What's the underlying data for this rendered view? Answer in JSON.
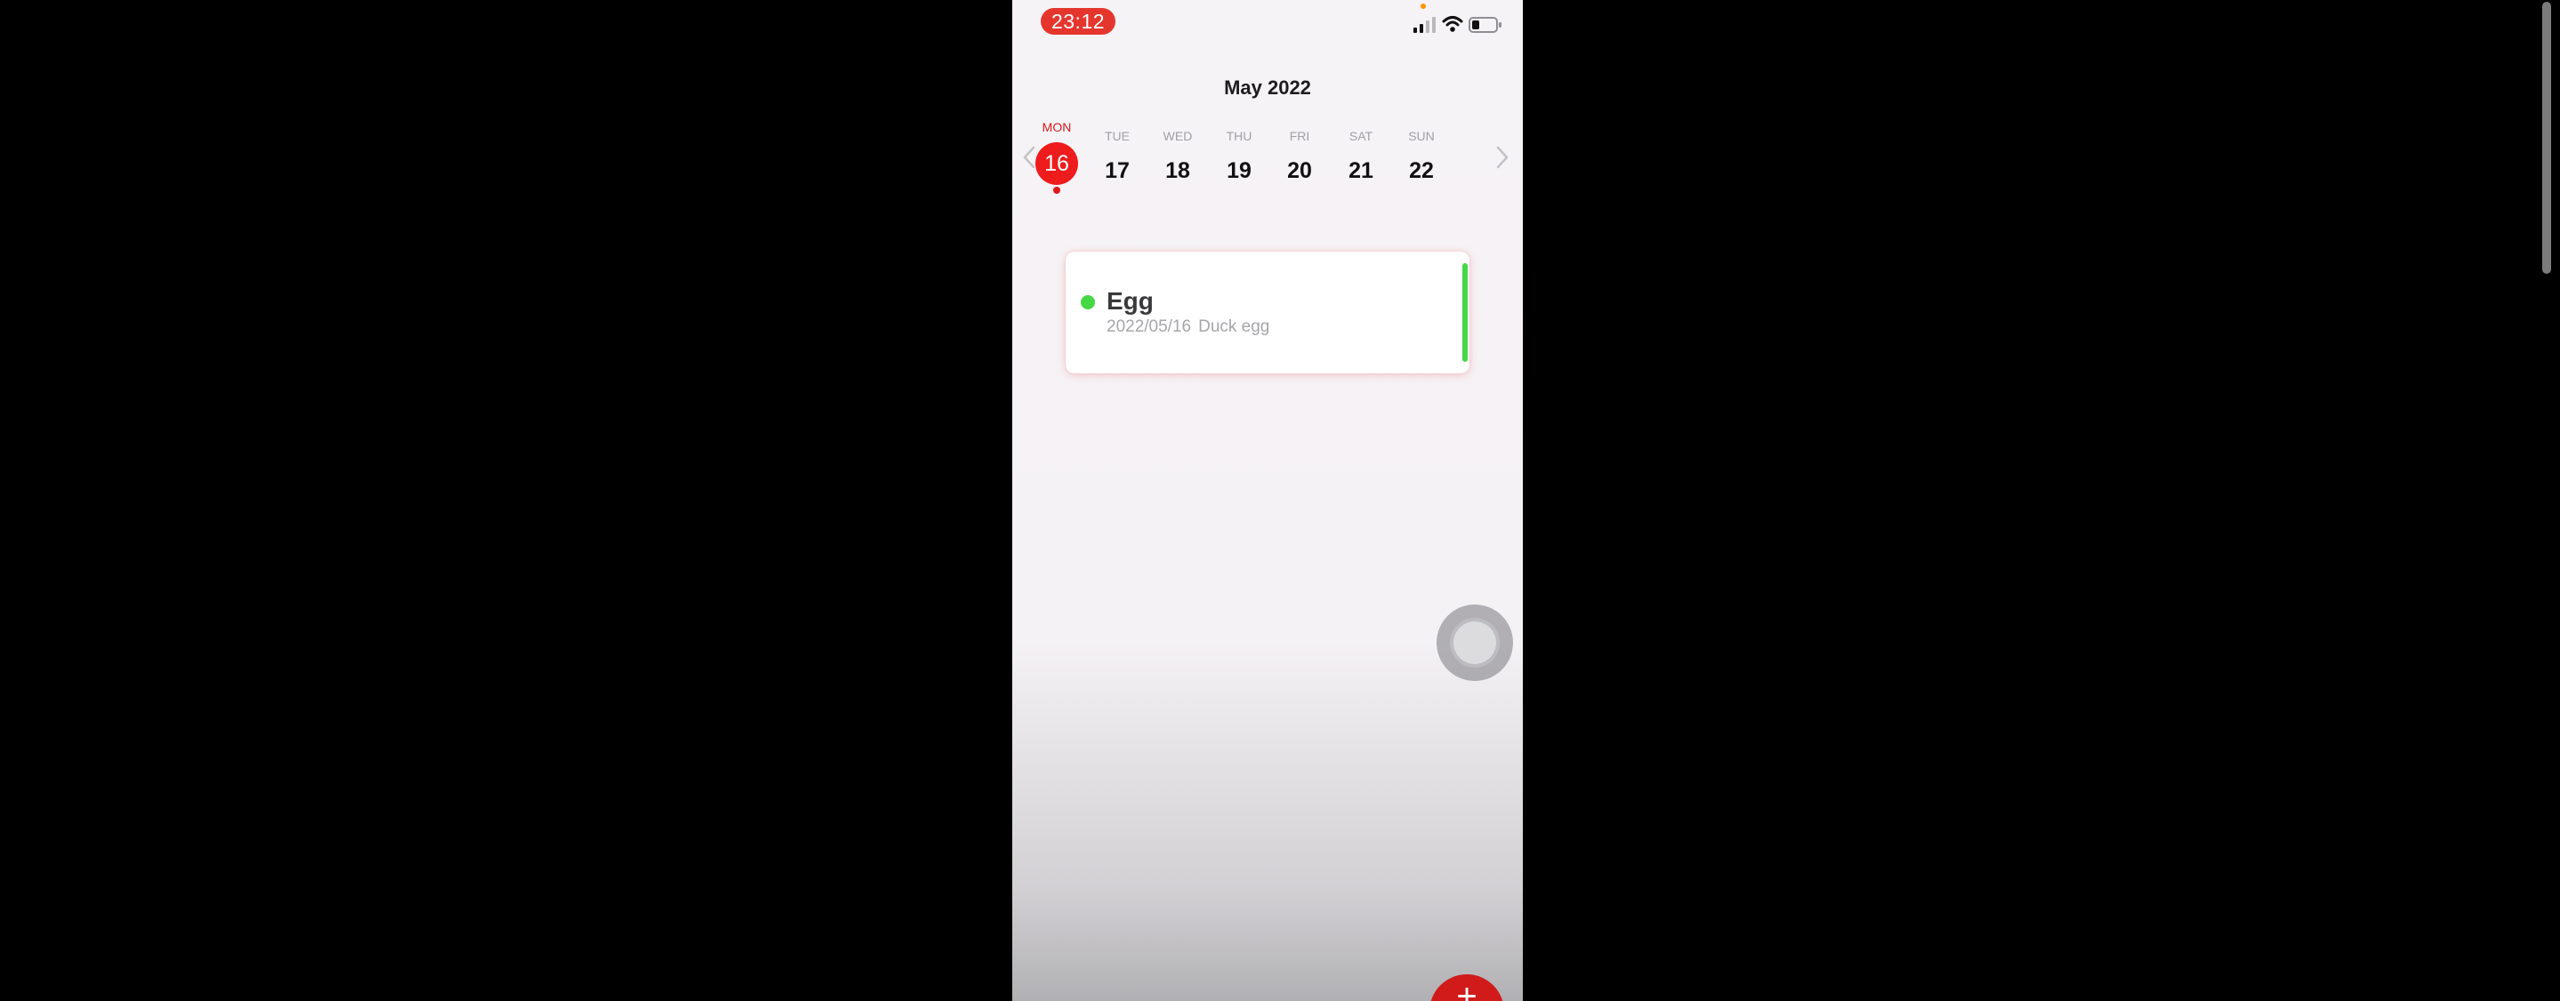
{
  "status_bar": {
    "time": "23:12",
    "accent_color": "#e5362e",
    "privacy_dot_color": "#ff9500",
    "icons": [
      "signal-icon",
      "wifi-icon",
      "battery-icon"
    ]
  },
  "calendar": {
    "month_title": "May 2022",
    "prev_icon": "chevron-left-icon",
    "next_icon": "chevron-right-icon",
    "days": [
      {
        "dow": "MON",
        "num": "16",
        "selected": true,
        "has_event": true
      },
      {
        "dow": "TUE",
        "num": "17"
      },
      {
        "dow": "WED",
        "num": "18"
      },
      {
        "dow": "THU",
        "num": "19"
      },
      {
        "dow": "FRI",
        "num": "20"
      },
      {
        "dow": "SAT",
        "num": "21"
      },
      {
        "dow": "SUN",
        "num": "22"
      }
    ],
    "selected_color": "#ee1c1c"
  },
  "entries": [
    {
      "title": "Egg",
      "date": "2022/05/16",
      "note": "Duck egg",
      "color": "#44d944"
    }
  ],
  "floating": {
    "assistive_touch_icon": "assistive-touch-icon",
    "add_button_label": "+",
    "add_button_color": "#d11a1a"
  }
}
